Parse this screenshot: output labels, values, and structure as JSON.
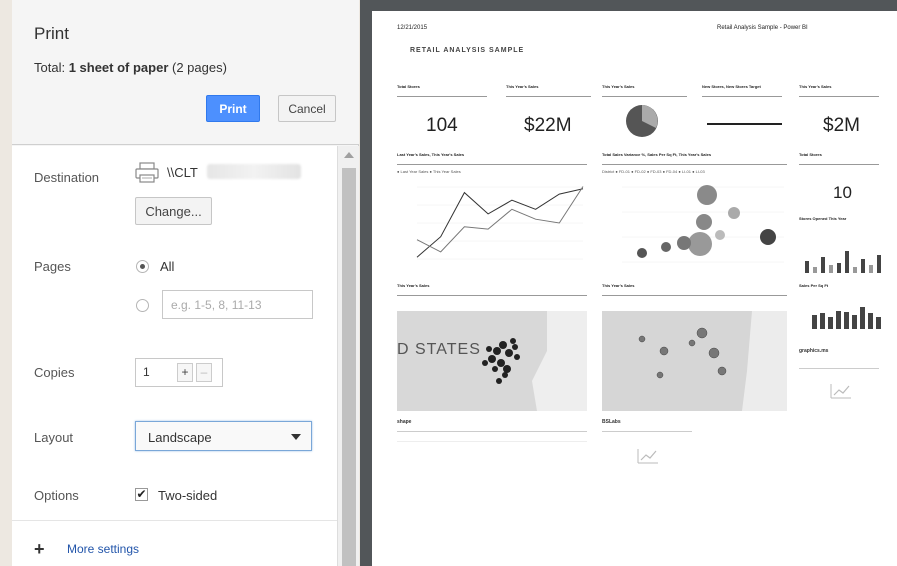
{
  "dialog": {
    "title": "Print",
    "total_prefix": "Total: ",
    "total_bold": "1 sheet of paper",
    "total_suffix": " (2 pages)",
    "print_label": "Print",
    "cancel_label": "Cancel"
  },
  "settings": {
    "destination_label": "Destination",
    "destination_name": "\\\\CLT",
    "change_label": "Change...",
    "pages_label": "Pages",
    "pages_all": "All",
    "pages_range_placeholder": "e.g. 1-5, 8, 11-13",
    "copies_label": "Copies",
    "copies_value": "1",
    "copies_plus": "+",
    "copies_minus": "–",
    "layout_label": "Layout",
    "layout_value": "Landscape",
    "options_label": "Options",
    "two_sided_label": "Two-sided",
    "two_sided_checked": true,
    "more_settings_plus": "+",
    "more_settings_label": "More settings"
  },
  "preview": {
    "date": "12/21/2015",
    "doc_title": "Retail Analysis Sample - Power BI",
    "report_title": "RETAIL ANALYSIS SAMPLE",
    "card_total_stores_title": "Total Stores",
    "card_total_stores_value": "104",
    "card_sales_title": "This Year's Sales",
    "card_sales_value": "$22M",
    "card_sales2_title": "This Year's Sales",
    "card_new_stores_title": "New Stores, New Stores Target",
    "card_sales3_title": "This Year's Sales",
    "card_sales3_value": "$2M",
    "line_chart_title": "Last Year's Sales, This Year's Sales",
    "line_legend": "● Last Year Sales  ● This Year Sales",
    "bubble_title": "Total Sales Variance %, Sales Per Sq Ft, This Year's Sales",
    "bubble_legend": "District ● FD-01 ● FD-02 ● FD-03 ● FD-04 ● LI-01 ● LI-03",
    "card_total_stores2_title": "Total Stores",
    "card_total_stores2_value": "10",
    "stores_opened_title": "Stores Opened This Year",
    "map1_title": "This Year's Sales",
    "map1_label": "D STATES",
    "map2_title": "This Year's Sales",
    "sales_per_sqft_title": "Sales Per Sq Ft",
    "graphics_label": "graphics.ms",
    "shape_label": "shape",
    "blank_label": "BSLabs"
  },
  "line_points": {
    "last_year": [
      0.05,
      0.32,
      0.9,
      0.62,
      0.8,
      0.68,
      0.88,
      0.95
    ],
    "this_year": [
      0.28,
      0.12,
      0.45,
      0.42,
      0.68,
      0.55,
      0.5,
      0.98
    ]
  },
  "accent": "#4d90fe"
}
